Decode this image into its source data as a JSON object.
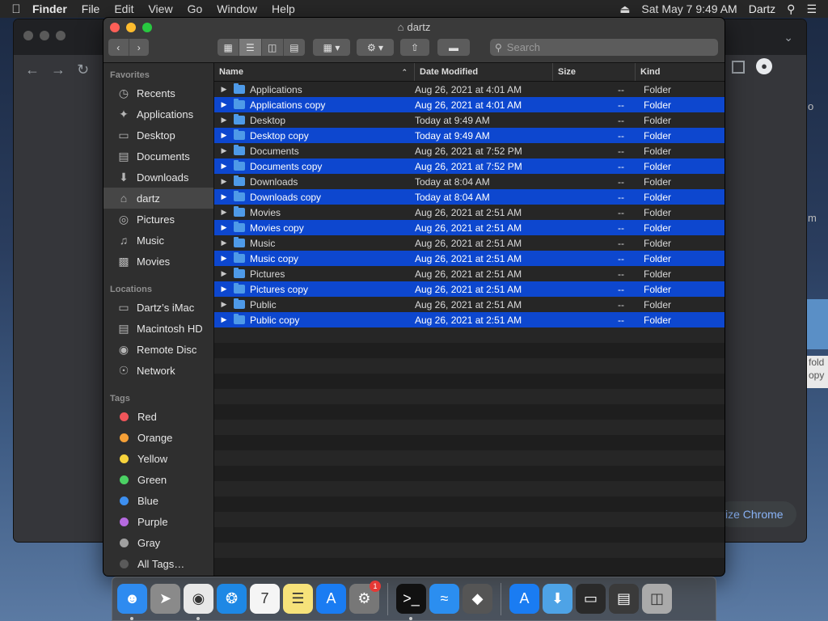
{
  "menubar": {
    "apple": "",
    "items": [
      "Finder",
      "File",
      "Edit",
      "View",
      "Go",
      "Window",
      "Help"
    ],
    "datetime": "Sat May 7  9:49 AM",
    "user": "Dartz"
  },
  "chrome": {
    "customize_label": "ize Chrome",
    "fragment_1": "o",
    "fragment_2": "m",
    "fragment_3": "fold",
    "fragment_4": "opy"
  },
  "finder": {
    "title": "dartz",
    "search_placeholder": "Search",
    "sidebar": {
      "favorites_label": "Favorites",
      "favorites": [
        {
          "label": "Recents",
          "icon": "clock-icon"
        },
        {
          "label": "Applications",
          "icon": "applications-icon"
        },
        {
          "label": "Desktop",
          "icon": "desktop-icon"
        },
        {
          "label": "Documents",
          "icon": "documents-icon"
        },
        {
          "label": "Downloads",
          "icon": "downloads-icon"
        },
        {
          "label": "dartz",
          "icon": "home-icon"
        },
        {
          "label": "Pictures",
          "icon": "camera-icon"
        },
        {
          "label": "Music",
          "icon": "music-note-icon"
        },
        {
          "label": "Movies",
          "icon": "film-icon"
        }
      ],
      "locations_label": "Locations",
      "locations": [
        {
          "label": "Dartz’s iMac",
          "icon": "imac-icon"
        },
        {
          "label": "Macintosh HD",
          "icon": "disk-icon"
        },
        {
          "label": "Remote Disc",
          "icon": "disc-icon"
        },
        {
          "label": "Network",
          "icon": "globe-icon"
        }
      ],
      "tags_label": "Tags",
      "tags": [
        {
          "label": "Red",
          "color": "#f0555a"
        },
        {
          "label": "Orange",
          "color": "#f5a037"
        },
        {
          "label": "Yellow",
          "color": "#f7d33c"
        },
        {
          "label": "Green",
          "color": "#4bd164"
        },
        {
          "label": "Blue",
          "color": "#3d8ff0"
        },
        {
          "label": "Purple",
          "color": "#b66ae0"
        },
        {
          "label": "Gray",
          "color": "#a0a0a0"
        },
        {
          "label": "All Tags…",
          "color": "#5a5a5a"
        }
      ]
    },
    "columns": {
      "name": "Name",
      "date": "Date Modified",
      "size": "Size",
      "kind": "Kind"
    },
    "rows": [
      {
        "name": "Applications",
        "date": "Aug 26, 2021 at 4:01 AM",
        "size": "--",
        "kind": "Folder",
        "selected": false
      },
      {
        "name": "Applications copy",
        "date": "Aug 26, 2021 at 4:01 AM",
        "size": "--",
        "kind": "Folder",
        "selected": true
      },
      {
        "name": "Desktop",
        "date": "Today at 9:49 AM",
        "size": "--",
        "kind": "Folder",
        "selected": false
      },
      {
        "name": "Desktop copy",
        "date": "Today at 9:49 AM",
        "size": "--",
        "kind": "Folder",
        "selected": true
      },
      {
        "name": "Documents",
        "date": "Aug 26, 2021 at 7:52 PM",
        "size": "--",
        "kind": "Folder",
        "selected": false
      },
      {
        "name": "Documents copy",
        "date": "Aug 26, 2021 at 7:52 PM",
        "size": "--",
        "kind": "Folder",
        "selected": true
      },
      {
        "name": "Downloads",
        "date": "Today at 8:04 AM",
        "size": "--",
        "kind": "Folder",
        "selected": false
      },
      {
        "name": "Downloads copy",
        "date": "Today at 8:04 AM",
        "size": "--",
        "kind": "Folder",
        "selected": true
      },
      {
        "name": "Movies",
        "date": "Aug 26, 2021 at 2:51 AM",
        "size": "--",
        "kind": "Folder",
        "selected": false
      },
      {
        "name": "Movies copy",
        "date": "Aug 26, 2021 at 2:51 AM",
        "size": "--",
        "kind": "Folder",
        "selected": true
      },
      {
        "name": "Music",
        "date": "Aug 26, 2021 at 2:51 AM",
        "size": "--",
        "kind": "Folder",
        "selected": false
      },
      {
        "name": "Music copy",
        "date": "Aug 26, 2021 at 2:51 AM",
        "size": "--",
        "kind": "Folder",
        "selected": true
      },
      {
        "name": "Pictures",
        "date": "Aug 26, 2021 at 2:51 AM",
        "size": "--",
        "kind": "Folder",
        "selected": false
      },
      {
        "name": "Pictures copy",
        "date": "Aug 26, 2021 at 2:51 AM",
        "size": "--",
        "kind": "Folder",
        "selected": true
      },
      {
        "name": "Public",
        "date": "Aug 26, 2021 at 2:51 AM",
        "size": "--",
        "kind": "Folder",
        "selected": false
      },
      {
        "name": "Public copy",
        "date": "Aug 26, 2021 at 2:51 AM",
        "size": "--",
        "kind": "Folder",
        "selected": true
      }
    ]
  },
  "dock": {
    "apps": [
      {
        "name": "finder",
        "icon": "finder-icon",
        "bg": "#2e8bf0",
        "running": true
      },
      {
        "name": "launchpad",
        "icon": "rocket-icon",
        "bg": "#8a8a8a",
        "running": false
      },
      {
        "name": "chrome",
        "icon": "chrome-icon",
        "bg": "#e8e8e8",
        "running": true
      },
      {
        "name": "safari",
        "icon": "compass-icon",
        "bg": "#1e88e5",
        "running": false
      },
      {
        "name": "calendar",
        "icon": "calendar-icon",
        "bg": "#f5f5f5",
        "running": false
      },
      {
        "name": "notes",
        "icon": "notes-icon",
        "bg": "#f6e27a",
        "running": false
      },
      {
        "name": "app-store",
        "icon": "app-store-icon",
        "bg": "#1a7cf2",
        "running": false
      },
      {
        "name": "system-preferences",
        "icon": "gear-icon",
        "bg": "#777",
        "running": false,
        "badge": "1"
      },
      {
        "name": "terminal",
        "icon": "terminal-icon",
        "bg": "#111",
        "running": true
      },
      {
        "name": "wireless-diagnostics",
        "icon": "wifi-icon",
        "bg": "#2b8ef0",
        "running": false
      },
      {
        "name": "utility",
        "icon": "claw-icon",
        "bg": "#555",
        "running": false
      },
      {
        "name": "app-store-2",
        "icon": "app-store-icon",
        "bg": "#1a7cf2",
        "running": false
      },
      {
        "name": "downloads-folder",
        "icon": "folder-download-icon",
        "bg": "#4ea3e6",
        "running": false
      },
      {
        "name": "chrome-window",
        "icon": "window-icon",
        "bg": "#2a2a2a",
        "running": false
      },
      {
        "name": "stack",
        "icon": "stack-icon",
        "bg": "#3a3a3a",
        "running": false
      },
      {
        "name": "trash",
        "icon": "trash-icon",
        "bg": "#aaa",
        "running": false
      }
    ]
  }
}
